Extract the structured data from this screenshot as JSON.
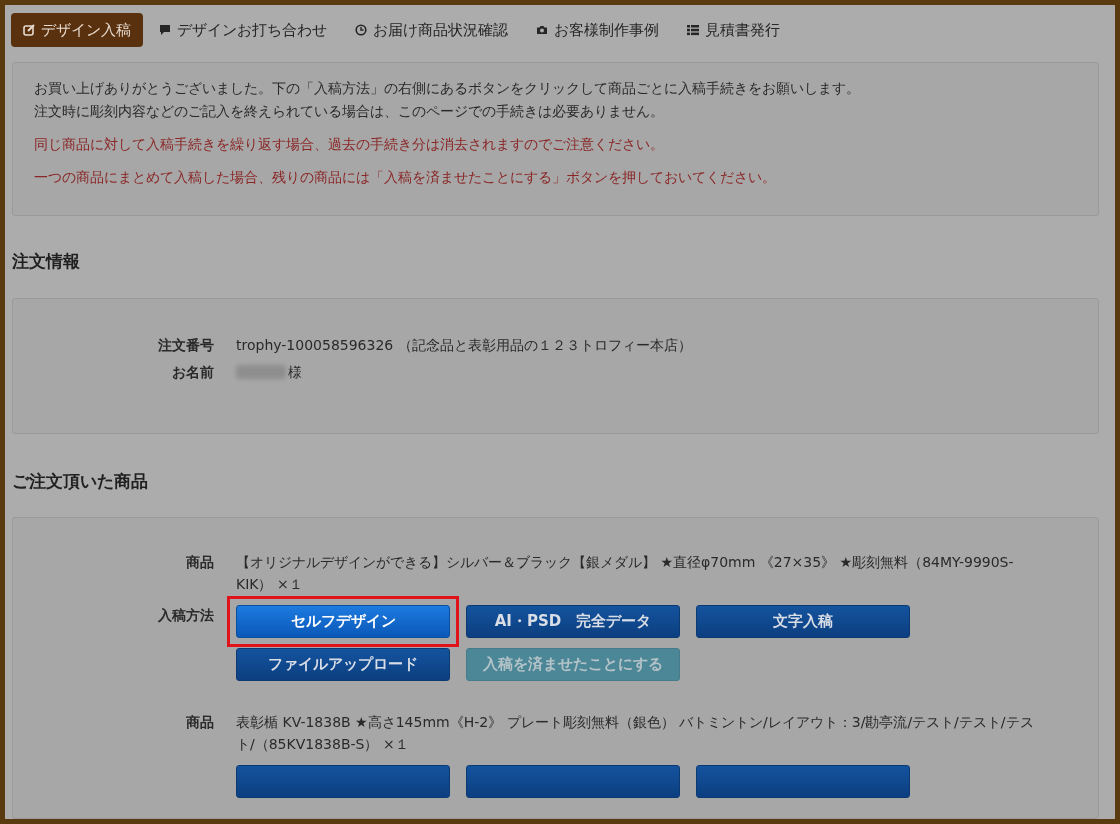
{
  "nav": [
    {
      "label": "デザイン入稿",
      "selected": true
    },
    {
      "label": "デザインお打ち合わせ",
      "selected": false
    },
    {
      "label": "お届け商品状況確認",
      "selected": false
    },
    {
      "label": "お客様制作事例",
      "selected": false
    },
    {
      "label": "見積書発行",
      "selected": false
    }
  ],
  "notice": {
    "lines": [
      "お買い上げありがとうございました。下の「入稿方法」の右側にあるボタンをクリックして商品ごとに入稿手続きをお願いします。",
      "注文時に彫刻内容などのご記入を終えられている場合は、このページでの手続きは必要ありません。"
    ],
    "warnings": [
      "同じ商品に対して入稿手続きを繰り返す場合、過去の手続き分は消去されますのでご注意ください。",
      "一つの商品にまとめて入稿した場合、残りの商品には「入稿を済ませたことにする」ボタンを押しておいてください。"
    ]
  },
  "order_info": {
    "title": "注文情報",
    "fields": [
      {
        "label": "注文番号",
        "value": "trophy-100058596326 （記念品と表彰用品の１２３トロフィー本店）",
        "redacted": false
      },
      {
        "label": "お名前",
        "value": "様",
        "redacted": true
      }
    ]
  },
  "products": {
    "title": "ご注文頂いた商品",
    "items": [
      {
        "label": "商品",
        "text": "【オリジナルデザインができる】シルバー＆ブラック【銀メダル】 ★直径φ70mm 《27×35》 ★彫刻無料（84MY-9990S-KIK） ×１",
        "method_label": "入稿方法",
        "buttons": [
          {
            "label": "セルフデザイン",
            "kind": "primary",
            "highlighted": true
          },
          {
            "label": "AI・PSD　完全データ",
            "kind": "default",
            "highlighted": false
          },
          {
            "label": "文字入稿",
            "kind": "default",
            "highlighted": false
          },
          {
            "label": "ファイルアップロード",
            "kind": "default",
            "highlighted": false
          },
          {
            "label": "入稿を済ませたことにする",
            "kind": "disabled",
            "highlighted": false
          }
        ]
      },
      {
        "label": "商品",
        "text": "表彰楯 KV-1838B ★高さ145mm《H-2》 プレート彫刻無料（銀色） バトミントン/レイアウト：3/勘亭流/テスト/テスト/テスト/（85KV1838B-S） ×１",
        "buttons": [
          {
            "kind": "default",
            "highlighted": false
          },
          {
            "kind": "default",
            "highlighted": false
          },
          {
            "kind": "default",
            "highlighted": false
          }
        ]
      }
    ]
  }
}
